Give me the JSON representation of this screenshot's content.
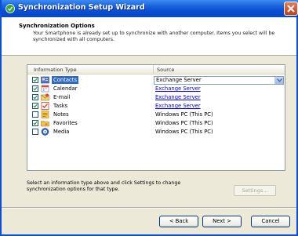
{
  "window": {
    "title": "Synchronization Setup Wizard",
    "accent": "#0a4fd6"
  },
  "header": {
    "title": "Synchronization Options",
    "description": "Your Smartphone is already set up to synchronize with another computer. Items you select will be synchronized with all computers."
  },
  "table": {
    "columns": [
      "Information Type",
      "Source"
    ],
    "rows": [
      {
        "label": "Contacts",
        "source": "Exchange Server",
        "checked": true,
        "icon": "contacts-icon",
        "selected": true,
        "source_style": "dropdown"
      },
      {
        "label": "Calendar",
        "source": "Exchange Server",
        "checked": true,
        "icon": "calendar-icon",
        "selected": false,
        "source_style": "link"
      },
      {
        "label": "E-mail",
        "source": "Exchange Server",
        "checked": true,
        "icon": "email-icon",
        "selected": false,
        "source_style": "link"
      },
      {
        "label": "Tasks",
        "source": "Exchange Server",
        "checked": true,
        "icon": "tasks-icon",
        "selected": false,
        "source_style": "link"
      },
      {
        "label": "Notes",
        "source": "Windows PC (This PC)",
        "checked": false,
        "icon": "notes-icon",
        "selected": false,
        "source_style": "text"
      },
      {
        "label": "Favorites",
        "source": "Windows PC (This PC)",
        "checked": true,
        "icon": "favorites-icon",
        "selected": false,
        "source_style": "text"
      },
      {
        "label": "Media",
        "source": "Windows PC (This PC)",
        "checked": false,
        "icon": "media-icon",
        "selected": false,
        "source_style": "text"
      }
    ]
  },
  "instructions": "Select an information type above and click Settings to change synchronization options for that type.",
  "buttons": {
    "settings": "Settings...",
    "back_prefix": "",
    "back_mnemonic": "B",
    "back_rest": "ack",
    "next_mnemonic": "N",
    "next_rest": "ext >",
    "back_full": "< Back",
    "next_full": "Next >",
    "cancel": "Cancel"
  }
}
